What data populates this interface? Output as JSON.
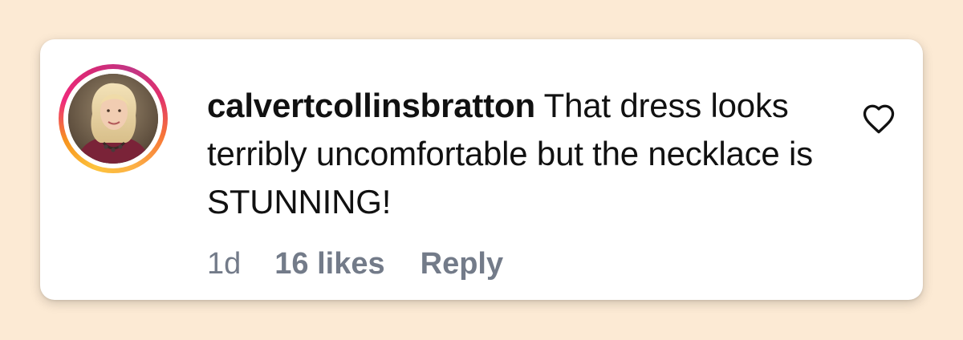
{
  "comment": {
    "username": "calvertcollinsbratton",
    "text": "That dress looks terribly uncomfortable but the necklace is STUNNING!",
    "time": "1d",
    "likes": "16 likes",
    "reply_label": "Reply"
  },
  "icons": {
    "like": "heart-icon",
    "avatar": "avatar"
  },
  "colors": {
    "background": "#fcead4",
    "card": "#ffffff",
    "text": "#111111",
    "meta": "#737b89"
  }
}
